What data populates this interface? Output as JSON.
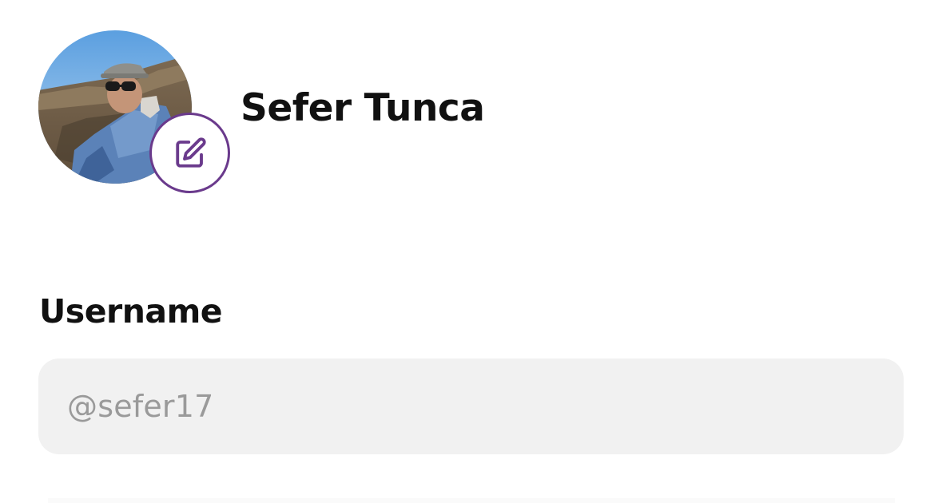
{
  "profile": {
    "name": "Sefer Tunca",
    "avatar_icon": "profile-photo",
    "edit_icon": "pencil-square-icon",
    "accent_color": "#6a3a8c"
  },
  "username": {
    "label": "Username",
    "value": "@sefer17"
  }
}
